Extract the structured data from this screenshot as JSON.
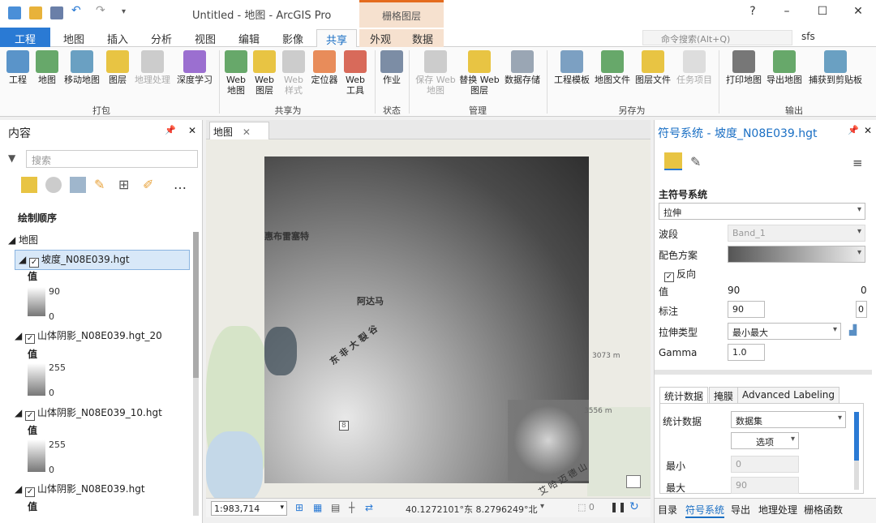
{
  "window": {
    "title": "Untitled - 地图 - ArcGIS Pro",
    "context_tab": "栅格图层",
    "help": "?",
    "minimize": "–",
    "maximize": "☐",
    "close": "✕"
  },
  "tabs": [
    "工程",
    "地图",
    "插入",
    "分析",
    "视图",
    "编辑",
    "影像",
    "共享",
    "外观",
    "数据"
  ],
  "command_search": {
    "placeholder": "命令搜索(Alt+Q)"
  },
  "user": "sfs",
  "ribbon": {
    "groups": [
      {
        "label": "打包"
      },
      {
        "label": "共享为"
      },
      {
        "label": "状态"
      },
      {
        "label": "管理"
      },
      {
        "label": "另存为"
      },
      {
        "label": "输出"
      }
    ],
    "buttons": {
      "project": "工程",
      "map": "地图",
      "mobile_map": "移动地图",
      "layer": "图层",
      "geoprocessing": "地理处理",
      "deep_learning": "深度学习",
      "web_map": "Web\n地图",
      "web_layer": "Web\n图层",
      "web_style": "Web\n样式",
      "locator": "定位器",
      "web_tool": "Web\n工具",
      "jobs": "作业",
      "save_web_map": "保存 Web\n地图",
      "replace_web_layer": "替换 Web\n图层",
      "data_store": "数据存储",
      "project_template": "工程模板",
      "map_file": "地图文件",
      "layer_file": "图层文件",
      "task_item": "任务项目",
      "print_map": "打印地图",
      "export_map": "导出地图",
      "capture_clipboard": "捕获到剪贴板"
    }
  },
  "contents": {
    "title": "内容",
    "search_placeholder": "搜索",
    "draw_order": "绘制顺序",
    "map": "地图",
    "layers": [
      {
        "name": "坡度_N08E039.hgt",
        "legend_label": "值",
        "max": "90",
        "min": "0"
      },
      {
        "name": "山体阴影_N08E039.hgt_20",
        "legend_label": "值",
        "max": "255",
        "min": "0"
      },
      {
        "name": "山体阴影_N08E039_10.hgt",
        "legend_label": "值",
        "max": "255",
        "min": "0"
      },
      {
        "name": "山体阴影_N08E039.hgt",
        "legend_label": "值"
      }
    ]
  },
  "map": {
    "tab": "地图",
    "labels": {
      "town1": "惠布雷塞特",
      "town2": "阿达马",
      "rift": "东非大裂谷",
      "elev1": "3073 m",
      "elev2": "3556 m",
      "mountains": "艾哈迈德山",
      "road": "8"
    },
    "scale": "1:983,714",
    "coords": "40.1272101°东 8.2796249°北"
  },
  "symbology": {
    "title": "符号系统 - 坡度_N08E039.hgt",
    "primary": "主符号系统",
    "type": "拉伸",
    "band_label": "波段",
    "band": "Band_1",
    "color_scheme_label": "配色方案",
    "invert": "反向",
    "value_label": "值",
    "value_max": "90",
    "value_min": "0",
    "label_label": "标注",
    "label_max": "90",
    "label_min": "0",
    "stretch_type_label": "拉伸类型",
    "stretch_type": "最小最大",
    "gamma_label": "Gamma",
    "gamma": "1.0",
    "tabs": [
      "统计数据",
      "掩膜",
      "Advanced Labeling"
    ],
    "stats_label": "统计数据",
    "stats_value": "数据集",
    "options": "选项",
    "min_label": "最小",
    "min_value": "0",
    "max_label": "最大",
    "max_value": "90"
  },
  "bottom_tabs": [
    "目录",
    "符号系统",
    "导出",
    "地理处理",
    "栅格函数"
  ]
}
